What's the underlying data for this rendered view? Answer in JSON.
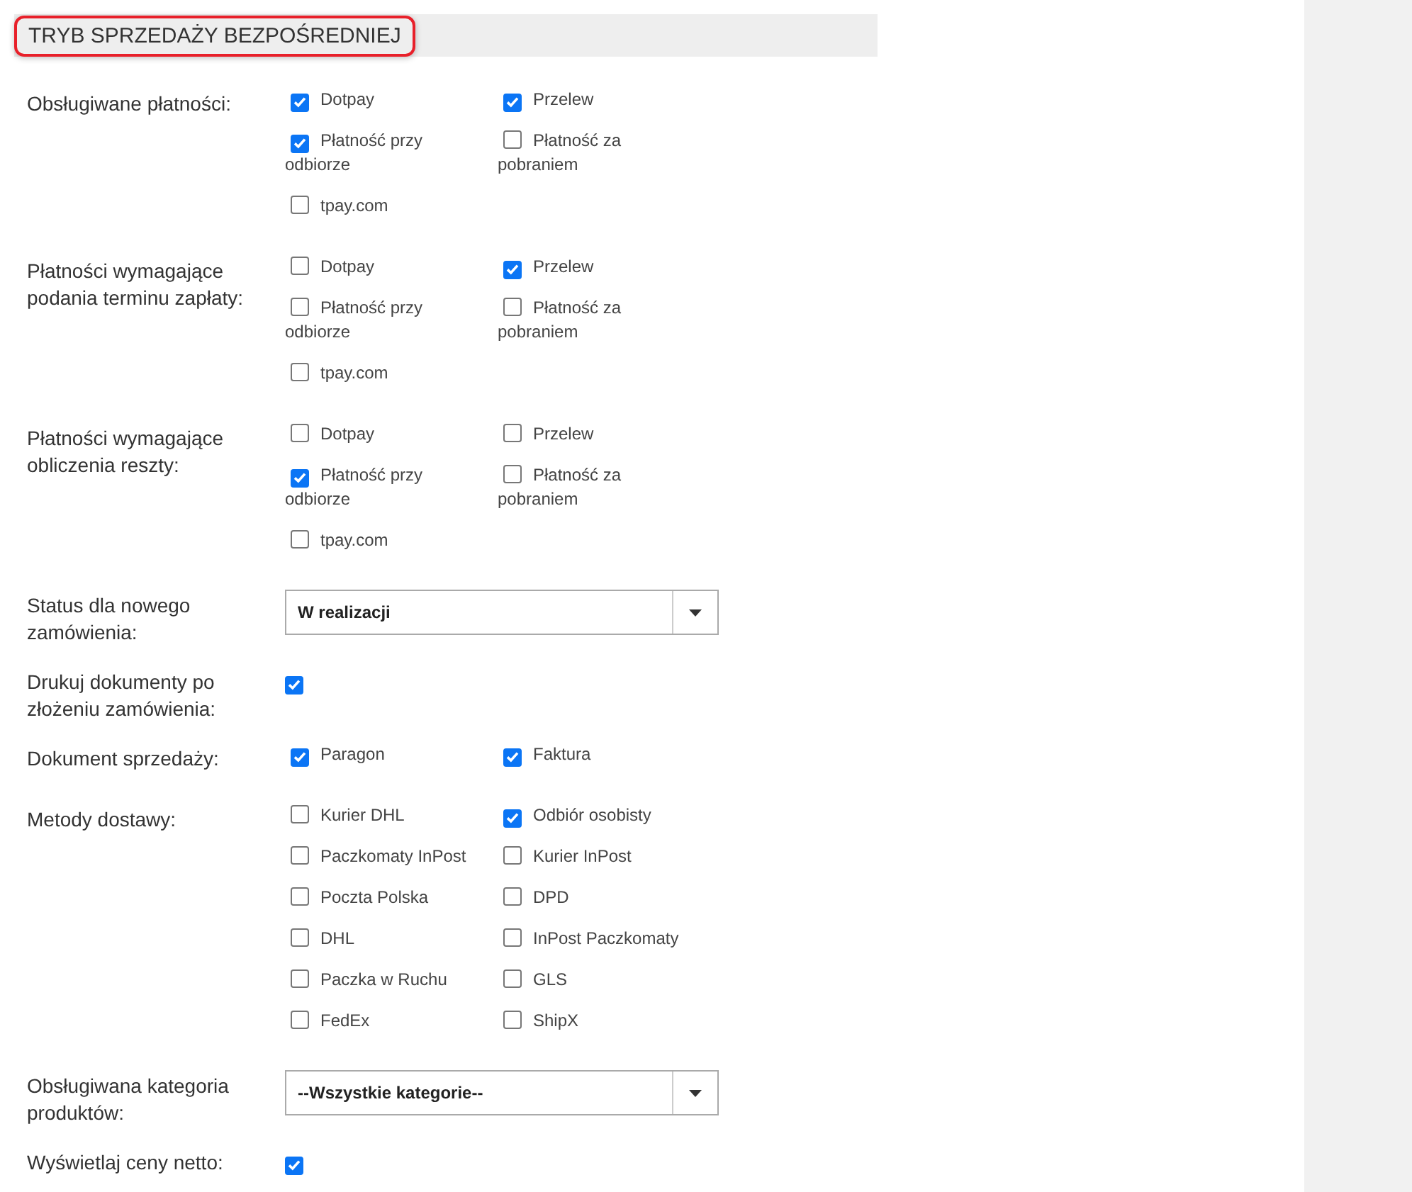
{
  "section": {
    "title": "TRYB SPRZEDAŻY BEZPOŚREDNIEJ",
    "highlighted": true
  },
  "rows": [
    {
      "kind": "checkgroup",
      "label": "Obsługiwane płatności:",
      "options": [
        {
          "label": "Dotpay",
          "checked": true
        },
        {
          "label": "Przelew",
          "checked": true
        },
        {
          "label": "Płatność przy odbiorze",
          "checked": true
        },
        {
          "label": "Płatność za pobraniem",
          "checked": false
        },
        {
          "label": "tpay.com",
          "checked": false
        }
      ]
    },
    {
      "kind": "checkgroup",
      "label": "Płatności wymagające podania terminu zapłaty:",
      "options": [
        {
          "label": "Dotpay",
          "checked": false
        },
        {
          "label": "Przelew",
          "checked": true
        },
        {
          "label": "Płatność przy odbiorze",
          "checked": false
        },
        {
          "label": "Płatność za pobraniem",
          "checked": false
        },
        {
          "label": "tpay.com",
          "checked": false
        }
      ]
    },
    {
      "kind": "checkgroup",
      "label": "Płatności wymagające obliczenia reszty:",
      "options": [
        {
          "label": "Dotpay",
          "checked": false
        },
        {
          "label": "Przelew",
          "checked": false
        },
        {
          "label": "Płatność przy odbiorze",
          "checked": true
        },
        {
          "label": "Płatność za pobraniem",
          "checked": false
        },
        {
          "label": "tpay.com",
          "checked": false
        }
      ]
    },
    {
      "kind": "select",
      "label": "Status dla nowego zamówienia:",
      "value": "W realizacji"
    },
    {
      "kind": "checkbox",
      "label": "Drukuj dokumenty po złożeniu zamówienia:",
      "checked": true
    },
    {
      "kind": "checkgroup",
      "label": "Dokument sprzedaży:",
      "options": [
        {
          "label": "Paragon",
          "checked": true
        },
        {
          "label": "Faktura",
          "checked": true
        }
      ]
    },
    {
      "kind": "checkgroup",
      "label": "Metody dostawy:",
      "options": [
        {
          "label": "Kurier DHL",
          "checked": false
        },
        {
          "label": "Odbiór osobisty",
          "checked": true
        },
        {
          "label": "Paczkomaty InPost",
          "checked": false
        },
        {
          "label": "Kurier InPost",
          "checked": false
        },
        {
          "label": "Poczta Polska",
          "checked": false
        },
        {
          "label": "DPD",
          "checked": false
        },
        {
          "label": "DHL",
          "checked": false
        },
        {
          "label": "InPost Paczkomaty",
          "checked": false
        },
        {
          "label": "Paczka w Ruchu",
          "checked": false
        },
        {
          "label": "GLS",
          "checked": false
        },
        {
          "label": "FedEx",
          "checked": false
        },
        {
          "label": "ShipX",
          "checked": false
        }
      ]
    },
    {
      "kind": "select",
      "label": "Obsługiwana kategoria produktów:",
      "value": "--Wszystkie kategorie--"
    },
    {
      "kind": "checkbox",
      "label": "Wyświetlaj ceny netto:",
      "checked": true
    }
  ]
}
